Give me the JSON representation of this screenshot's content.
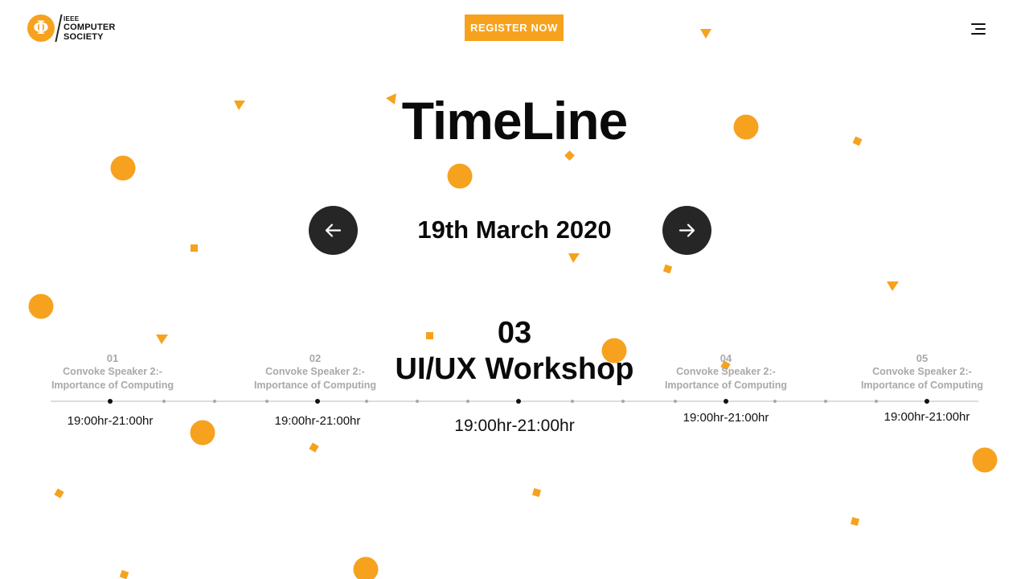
{
  "header": {
    "logo": {
      "glyph": "Φ",
      "line1": "IEEE",
      "line2": "COMPUTER",
      "line3": "SOCIETY"
    },
    "register_label": "REGISTER NOW",
    "menu_icon": "hamburger-menu-icon"
  },
  "page": {
    "title": "TimeLine",
    "date": "19th March 2020",
    "prev_icon": "arrow-left-icon",
    "next_icon": "arrow-right-icon"
  },
  "timeline": {
    "events": [
      {
        "num": "01",
        "title_line1": "Convoke Speaker 2:-",
        "title_line2": "Importance of Computing",
        "time": "19:00hr-21:00hr"
      },
      {
        "num": "02",
        "title_line1": "Convoke Speaker 2:-",
        "title_line2": "Importance of Computing",
        "time": "19:00hr-21:00hr"
      },
      {
        "num": "03",
        "title": "UI/UX Workshop",
        "time": "19:00hr-21:00hr",
        "active": true
      },
      {
        "num": "04",
        "title_line1": "Convoke Speaker 2:-",
        "title_line2": "Importance of Computing",
        "time": "19:00hr-21:00hr"
      },
      {
        "num": "05",
        "title_line1": "Convoke Speaker 2:-",
        "title_line2": "Importance of Computing",
        "time": "19:00hr-21:00hr"
      }
    ]
  },
  "colors": {
    "accent": "#f6a21e",
    "dark_button": "#262626",
    "inactive_text": "#a9a9a9",
    "axis": "#dcdcdc"
  }
}
